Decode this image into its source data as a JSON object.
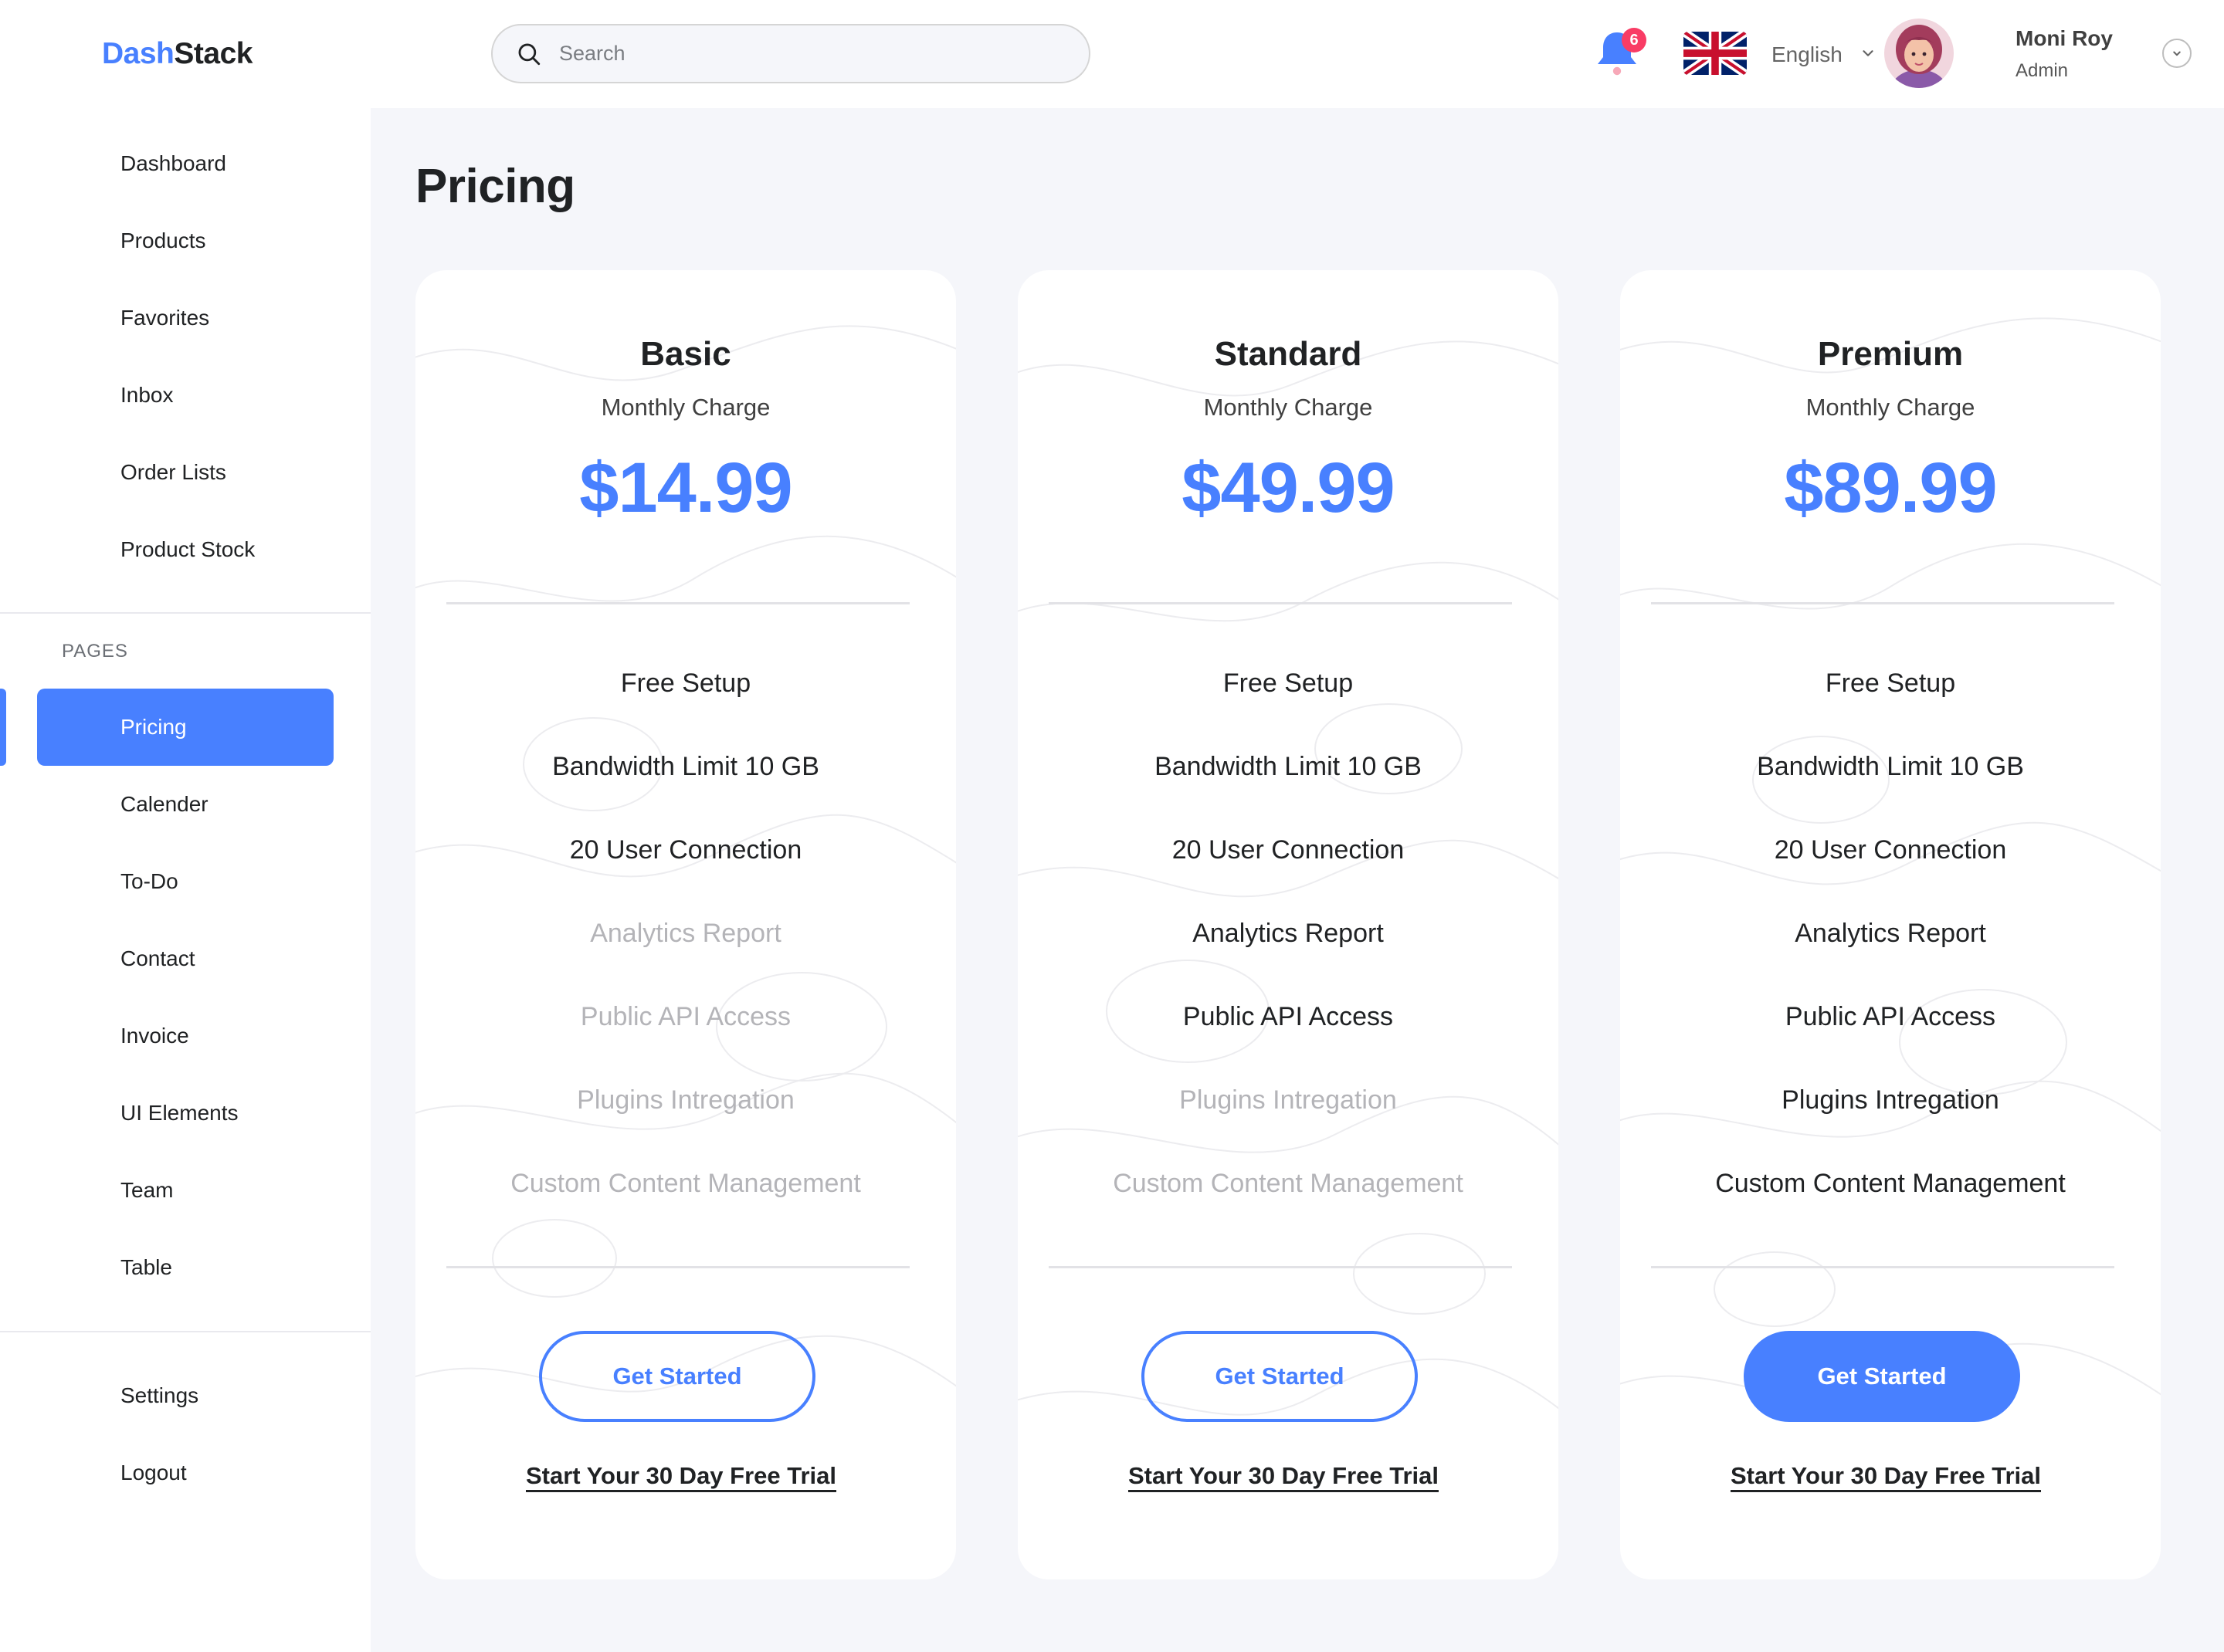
{
  "brand": {
    "part1": "Dash",
    "part2": "Stack"
  },
  "sidebar": {
    "main_items": [
      {
        "label": "Dashboard"
      },
      {
        "label": "Products"
      },
      {
        "label": "Favorites"
      },
      {
        "label": "Inbox"
      },
      {
        "label": "Order Lists"
      },
      {
        "label": "Product Stock"
      }
    ],
    "section_label": "PAGES",
    "page_items": [
      {
        "label": "Pricing",
        "active": true
      },
      {
        "label": "Calender"
      },
      {
        "label": "To-Do"
      },
      {
        "label": "Contact"
      },
      {
        "label": "Invoice"
      },
      {
        "label": "UI Elements"
      },
      {
        "label": "Team"
      },
      {
        "label": "Table"
      }
    ],
    "bottom_items": [
      {
        "label": "Settings"
      },
      {
        "label": "Logout"
      }
    ]
  },
  "header": {
    "search": {
      "placeholder": "Search",
      "value": ""
    },
    "notifications": {
      "count": "6"
    },
    "language": {
      "label": "English",
      "flag": "uk-flag-icon"
    },
    "user": {
      "name": "Moni Roy",
      "role": "Admin"
    }
  },
  "page": {
    "title": "Pricing"
  },
  "plans": [
    {
      "name": "Basic",
      "subtitle": "Monthly Charge",
      "price": "$14.99",
      "features": [
        {
          "label": "Free Setup",
          "included": true
        },
        {
          "label": "Bandwidth Limit 10 GB",
          "included": true
        },
        {
          "label": "20 User Connection",
          "included": true
        },
        {
          "label": "Analytics Report",
          "included": false
        },
        {
          "label": "Public API Access",
          "included": false
        },
        {
          "label": "Plugins Intregation",
          "included": false
        },
        {
          "label": "Custom Content Management",
          "included": false
        }
      ],
      "button_label": "Get Started",
      "button_filled": false,
      "trial_label": "Start Your 30 Day Free Trial"
    },
    {
      "name": "Standard",
      "subtitle": "Monthly Charge",
      "price": "$49.99",
      "features": [
        {
          "label": "Free Setup",
          "included": true
        },
        {
          "label": "Bandwidth Limit 10 GB",
          "included": true
        },
        {
          "label": "20 User Connection",
          "included": true
        },
        {
          "label": "Analytics Report",
          "included": true
        },
        {
          "label": "Public API Access",
          "included": true
        },
        {
          "label": "Plugins Intregation",
          "included": false
        },
        {
          "label": "Custom Content Management",
          "included": false
        }
      ],
      "button_label": "Get Started",
      "button_filled": false,
      "trial_label": "Start Your 30 Day Free Trial"
    },
    {
      "name": "Premium",
      "subtitle": "Monthly Charge",
      "price": "$89.99",
      "features": [
        {
          "label": "Free Setup",
          "included": true
        },
        {
          "label": "Bandwidth Limit 10 GB",
          "included": true
        },
        {
          "label": "20 User Connection",
          "included": true
        },
        {
          "label": "Analytics Report",
          "included": true
        },
        {
          "label": "Public API Access",
          "included": true
        },
        {
          "label": "Plugins Intregation",
          "included": true
        },
        {
          "label": "Custom Content Management",
          "included": true
        }
      ],
      "button_label": "Get Started",
      "button_filled": true,
      "trial_label": "Start Your 30 Day Free Trial"
    }
  ],
  "colors": {
    "accent": "#4880ff",
    "badge": "#f93c65",
    "text": "#202224",
    "muted_feature": "#b4b4b8",
    "page_bg": "#f5f6fa"
  }
}
